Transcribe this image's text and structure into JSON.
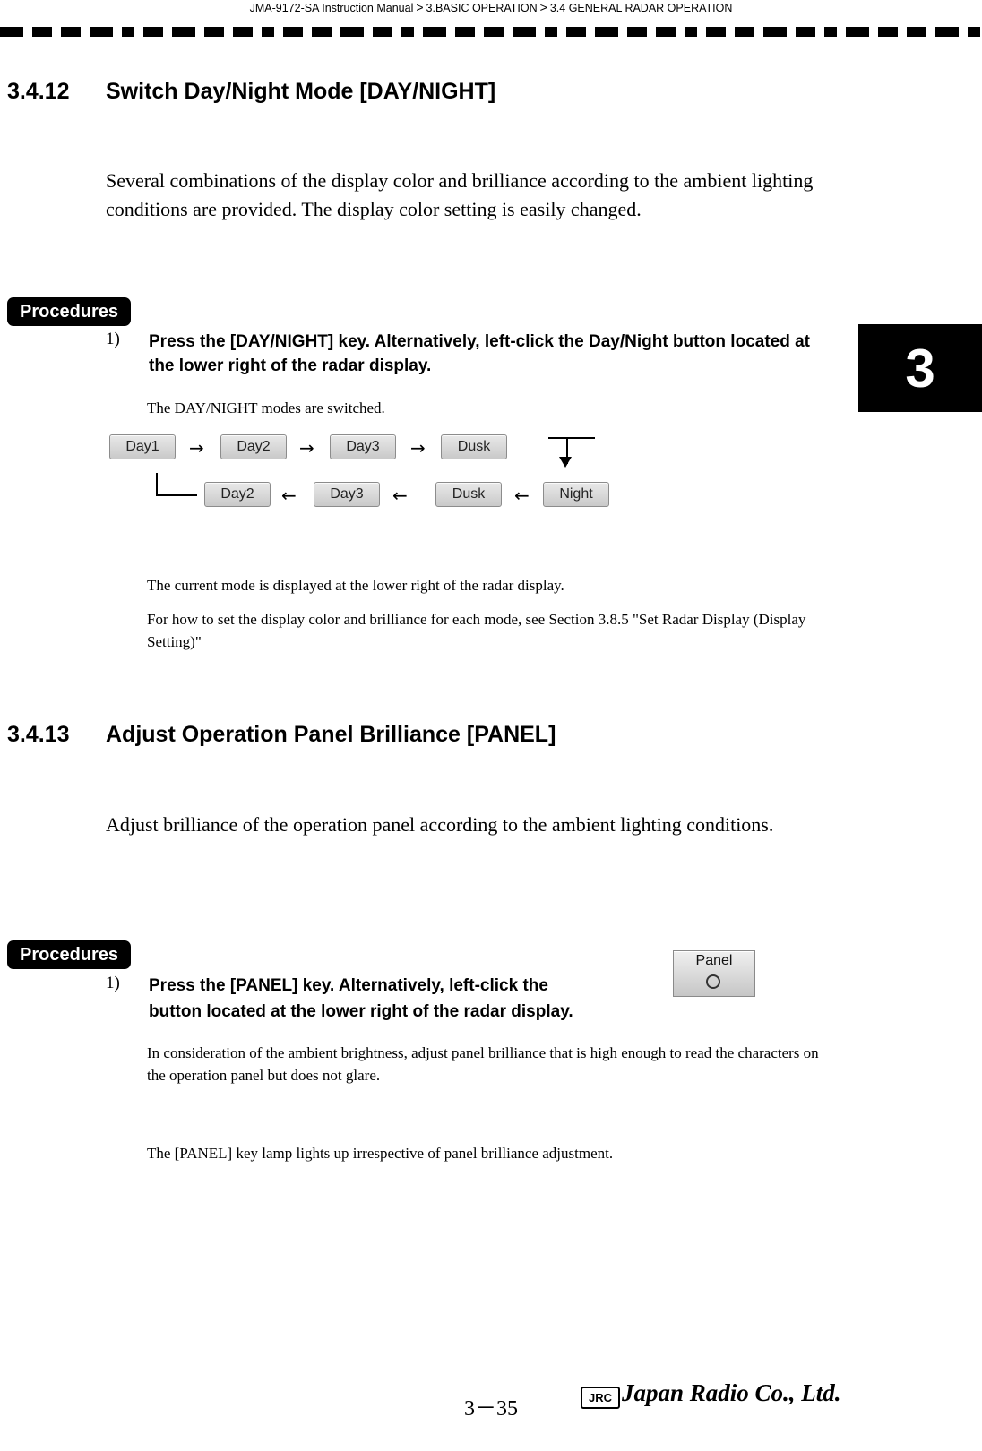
{
  "header": {
    "manual": "JMA-9172-SA Instruction Manual",
    "sep": ">",
    "crumb1": "3.BASIC OPERATION",
    "crumb2": "3.4  GENERAL RADAR OPERATION"
  },
  "chapter_tab": "3",
  "sections": [
    {
      "number": "3.4.12",
      "title": "Switch Day/Night Mode [DAY/NIGHT]",
      "intro": "Several combinations of the display color and brilliance according to the ambient lighting conditions are provided. The display color setting is easily changed.",
      "procedures_label": "Procedures",
      "step_number": "1)",
      "step_text": "Press the [DAY/NIGHT] key. Alternatively, left-click the  Day/Night button located at the lower right of the radar display.",
      "note1": "The DAY/NIGHT modes are switched.",
      "note2": "The current mode is displayed at the lower right of the radar display.",
      "note3": "For how to set the display color and brilliance for each mode, see Section 3.8.5 \"Set Radar Display (Display Setting)\""
    },
    {
      "number": "3.4.13",
      "title": "Adjust Operation Panel Brilliance [PANEL]",
      "intro": "Adjust brilliance of the operation panel according to the ambient lighting conditions.",
      "procedures_label": "Procedures",
      "step_number": "1)",
      "step_text_a": "Press the [PANEL] key. Alternatively, left-click the",
      "step_text_b": "button located at the lower right of the radar display.",
      "note1": "In consideration of the ambient brightness, adjust panel brilliance that is high enough to read the characters on the operation panel but does not glare.",
      "note2": "The [PANEL] key lamp lights up irrespective of panel brilliance adjustment."
    }
  ],
  "mode_flow": {
    "row1": [
      "Day1",
      "Day2",
      "Day3",
      "Dusk"
    ],
    "row2": [
      "Day2",
      "Day3",
      "Dusk",
      "Night"
    ],
    "arrow_right": "→",
    "arrow_left": "←"
  },
  "panel_button": {
    "label": "Panel",
    "icon": "circle-icon"
  },
  "footer": {
    "page": "3－35",
    "logo_mark": "JRC",
    "company": "Japan Radio Co., Ltd."
  }
}
